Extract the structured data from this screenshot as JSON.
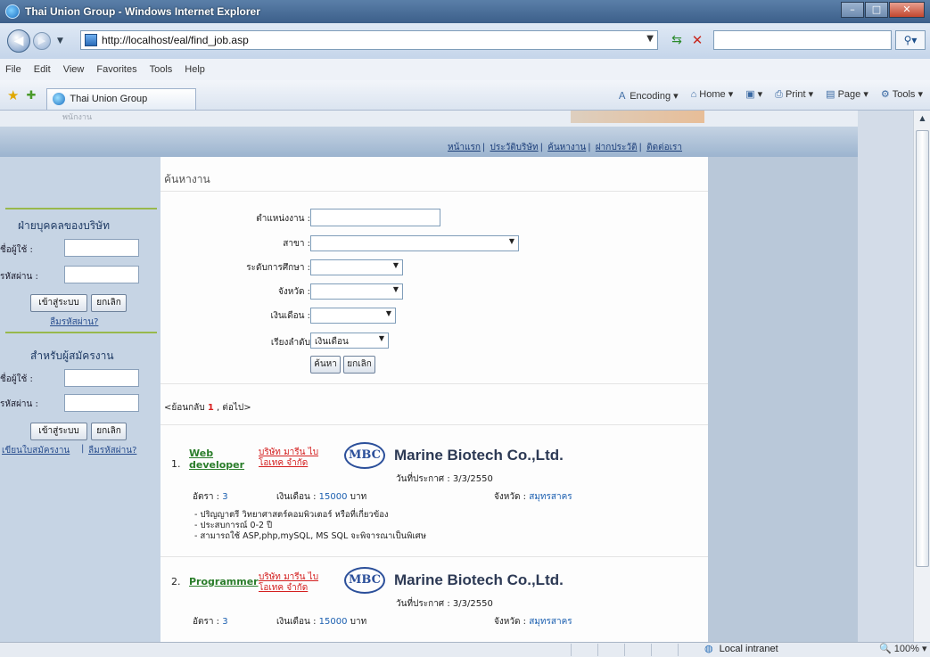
{
  "browser": {
    "window_title": "Thai Union Group - Windows Internet Explorer",
    "url": "http://localhost/eal/find_job.asp",
    "menu": [
      "File",
      "Edit",
      "View",
      "Favorites",
      "Tools",
      "Help"
    ],
    "tab_title": "Thai Union Group",
    "commands": [
      "Encoding",
      "Home",
      "Print",
      "Page",
      "Tools"
    ],
    "status_zone": "Local intranet",
    "zoom": "100%"
  },
  "site": {
    "header_faded_text": "พนักงาน",
    "top_nav": [
      "หน้าแรก",
      "ประวัติบริษัท",
      "ค้นหางาน",
      "ฝากประวัติ",
      "ติดต่อเรา"
    ]
  },
  "sidebar": {
    "company_heading": "ฝ่ายบุคคลของบริษัท",
    "username_label": "ชื่อผู้ใช้ :",
    "password_label": "รหัสผ่าน :",
    "login_button": "เข้าสู่ระบบ",
    "cancel_button": "ยกเลิก",
    "forgot_password": "ลืมรหัสผ่าน?",
    "applicant_heading": "สำหรับผู้สมัครงาน",
    "register_link": "เขียนใบสมัครงาน",
    "separator": "|"
  },
  "search": {
    "breadcrumb": "ค้นหางาน",
    "position_label": "ตำแหน่งงาน :",
    "branch_label": "สาขา :",
    "education_label": "ระดับการศึกษา :",
    "province_label": "จังหวัด :",
    "salary_label": "เงินเดือน :",
    "sort_label": "เรียงลำดับ",
    "sort_value": "เงินเดือน",
    "search_button": "ค้นหา",
    "cancel_button": "ยกเลิก"
  },
  "pager": {
    "prefix": "<ย้อนกลับ",
    "current": "1",
    "suffix": ", ต่อไป>"
  },
  "jobs": [
    {
      "number": "1.",
      "title_line1": "Web",
      "title_line2": "developer",
      "company_line1": "บริษัท มารีน ไบ",
      "company_line2": "โอเทค จำกัด",
      "logo_text": "MBC",
      "company_name": "Marine Biotech Co.,Ltd.",
      "posted_label": "วันที่ประกาศ :",
      "posted_date": "3/3/2550",
      "rate_label": "อัตรา :",
      "rate": "3",
      "salary_label": "เงินเดือน :",
      "salary": "15000",
      "salary_unit": "บาท",
      "province_label": "จังหวัด :",
      "province": "สมุทรสาคร",
      "requirements": [
        "- ปริญญาตรี วิทยาศาสตร์คอมพิวเตอร์ หรือที่เกี่ยวข้อง",
        "- ประสบการณ์ 0-2 ปี",
        "- สามารถใช้ ASP,php,mySQL, MS SQL จะพิจารณาเป็นพิเศษ"
      ]
    },
    {
      "number": "2.",
      "title_line1": "Programmer",
      "company_line1": "บริษัท มารีน ไบ",
      "company_line2": "โอเทค จำกัด",
      "logo_text": "MBC",
      "company_name": "Marine Biotech Co.,Ltd.",
      "posted_label": "วันที่ประกาศ :",
      "posted_date": "3/3/2550",
      "rate_label": "อัตรา :",
      "rate": "3",
      "salary_label": "เงินเดือน :",
      "salary": "15000",
      "salary_unit": "บาท",
      "province_label": "จังหวัด :",
      "province": "สมุทรสาคร"
    }
  ]
}
